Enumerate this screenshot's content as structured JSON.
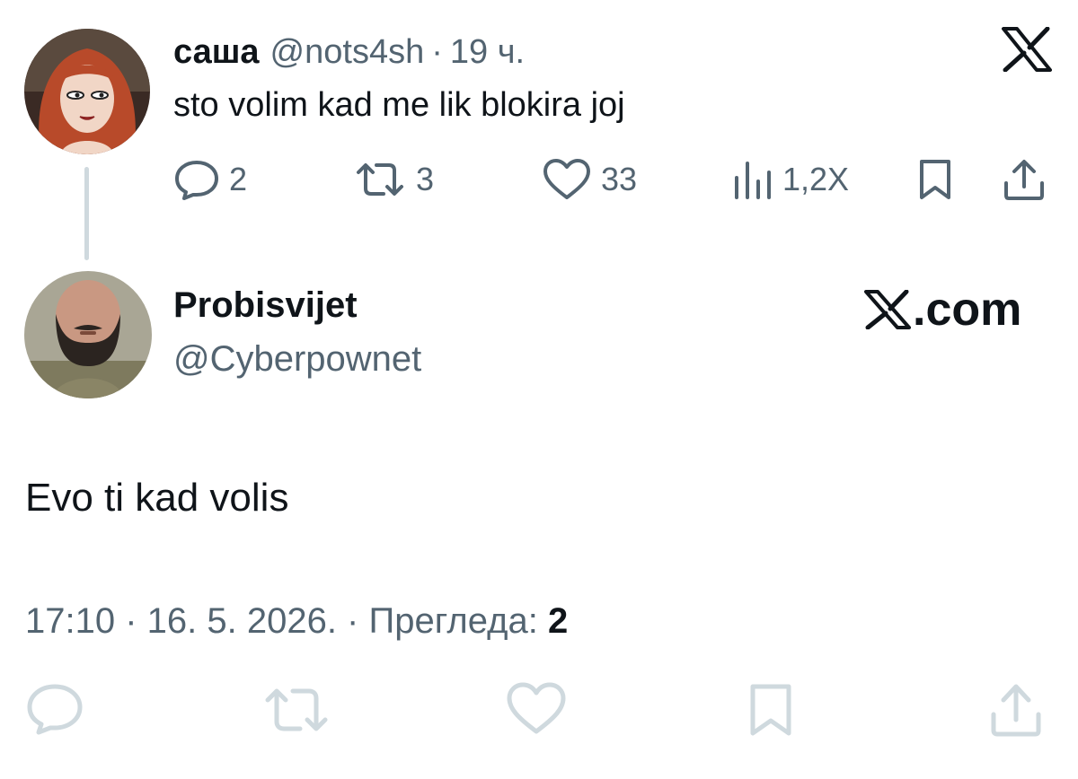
{
  "parent_tweet": {
    "display_name": "саша",
    "handle": "@nots4sh",
    "separator": "·",
    "time_ago": "19 ч.",
    "text": "sto volim kad me lik blokira joj",
    "stats": {
      "replies": "2",
      "reposts": "3",
      "likes": "33",
      "views": "1,2X"
    }
  },
  "main_tweet": {
    "display_name": "Probisvijet",
    "handle": "@Cyberpownet",
    "text": "Evo ti kad volis",
    "timestamp": "17:10 · 16. 5. 2026. · Прегледа:",
    "views": "2"
  },
  "watermark": {
    "label": ".com"
  },
  "icons": {
    "x_logo": "x-logo-icon",
    "reply": "reply-icon",
    "repost": "repost-icon",
    "like": "heart-icon",
    "views": "views-icon",
    "bookmark": "bookmark-icon",
    "share": "share-icon"
  },
  "colors": {
    "text_primary": "#0f1419",
    "text_secondary": "#536471",
    "thread_line": "#cfd9de",
    "inactive_icon": "#cfd9de"
  }
}
